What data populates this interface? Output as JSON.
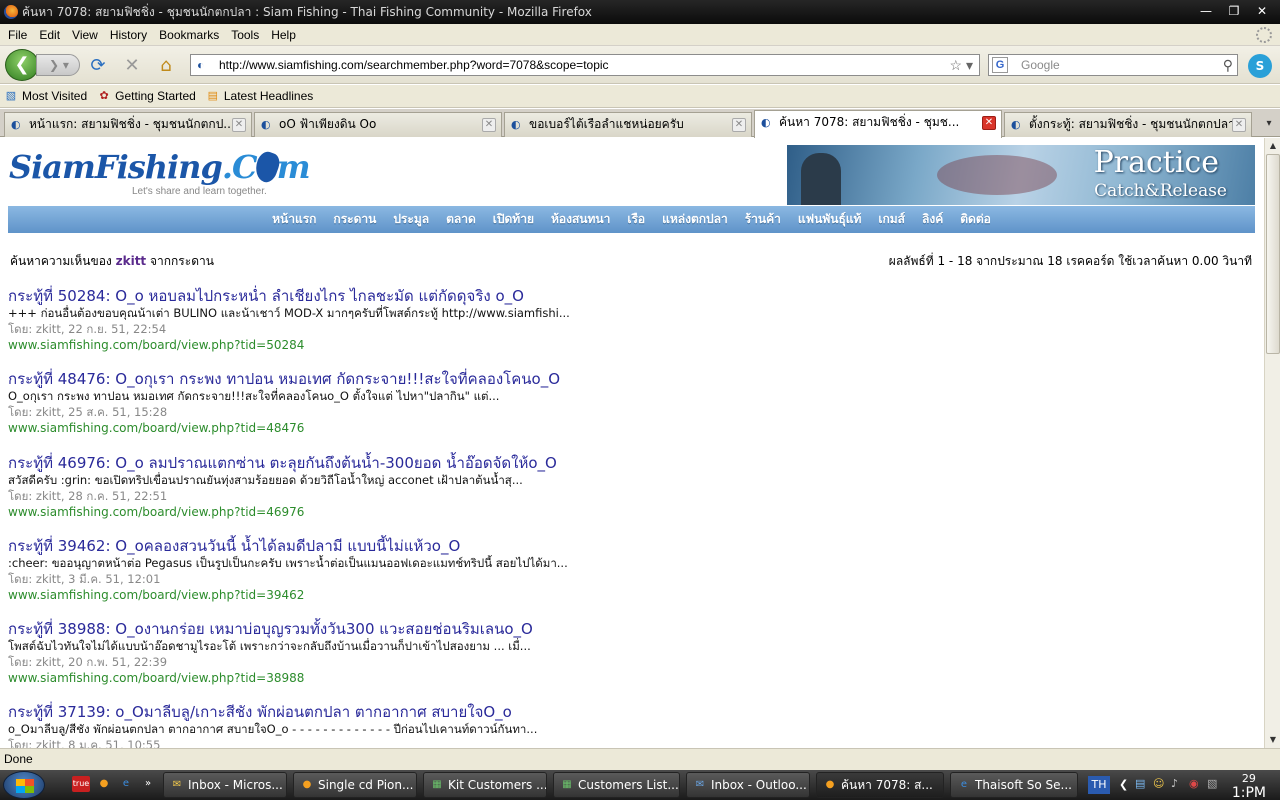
{
  "window": {
    "title": "ค้นหา 7078: สยามฟิชชิ่ง - ชุมชนนักตกปลา : Siam Fishing - Thai Fishing Community - Mozilla Firefox"
  },
  "menu": [
    "File",
    "Edit",
    "View",
    "History",
    "Bookmarks",
    "Tools",
    "Help"
  ],
  "nav": {
    "url": "http://www.siamfishing.com/searchmember.php?word=7078&scope=topic",
    "search_placeholder": "Google"
  },
  "bookmarks": [
    "Most Visited",
    "Getting Started",
    "Latest Headlines"
  ],
  "tabs": [
    {
      "label": "หน้าแรก: สยามฟิชชิ่ง - ชุมชนนักตกป..."
    },
    {
      "label": "oO ฟ้าเพียงดิน Oo"
    },
    {
      "label": "ขอเบอร์ไต้เรือลำแชหน่อยครับ"
    },
    {
      "label": "ค้นหา 7078: สยามฟิชชิ่ง - ชุมช..."
    },
    {
      "label": "ตั้งกระทู้: สยามฟิชชิ่ง - ชุมชนนักตกปลา..."
    }
  ],
  "site": {
    "logo": "SiamFishing",
    "logo_com": ".Com",
    "tagline": "Let's share and learn together.",
    "banner_title": "Practice",
    "banner_sub": "Catch&Release",
    "nav": [
      "หน้าแรก",
      "กระดาน",
      "ประมูล",
      "ตลาด",
      "เปิดท้าย",
      "ห้องสนทนา",
      "เรือ",
      "แหล่งตกปลา",
      "ร้านค้า",
      "แฟนพันธุ์แท้",
      "เกมส์",
      "ลิงค์",
      "ติดต่อ"
    ]
  },
  "search": {
    "prefix": "ค้นหาความเห็นของ",
    "user": "zkitt",
    "suffix": "จากกระดาน",
    "results_info": "ผลลัพธ์ที่ 1 - 18 จากประมาณ 18 เรคคอร์ด ใช้เวลาค้นหา 0.00 วินาที"
  },
  "results": [
    {
      "title": "กระทู้ที่ 50284: O_o หอบลมไปกระหน่ำ ลำเชียงไกร ไกลชะมัด แต่กัดดุจริง o_O",
      "snippet": "+++ ก่อนอื่นต้องขอบคุณน้าเต่า BULINO และน้าเชาว์ MOD-X มากๆครับที่โพสต์กระทู้ http://www.siamfishi...",
      "meta": "โดย: zkitt, 22 ก.ย. 51, 22:54",
      "url": "www.siamfishing.com/board/view.php?tid=50284"
    },
    {
      "title": "กระทู้ที่ 48476: O_oกุเรา กระพง ทาปอน หมอเทศ กัดกระจาย!!!สะใจที่คลองโคนo_O",
      "snippet": "O_oกุเรา กระพง ทาปอน หมอเทศ กัดกระจาย!!!สะใจที่คลองโคนo_O ตั้งใจแต่ ไปหา\"ปลากิน\" แต่...",
      "meta": "โดย: zkitt, 25 ส.ค. 51, 15:28",
      "url": "www.siamfishing.com/board/view.php?tid=48476"
    },
    {
      "title": "กระทู้ที่ 46976: O_o ลมปราณแตกซ่าน ตะลุยกันถึงต้นน้ำ-300ยอด น้ำอ๊อดจัดให้o_O",
      "snippet": "สวัสดีครับ :grin: ขอเปิดทริปเขื่อนปราณยันทุ่งสามร้อยยอด ด้วยวิถีโอน้ำใหญ่ acconet เฝ้าปลาต้นน้ำสุ...",
      "meta": "โดย: zkitt, 28 ก.ค. 51, 22:51",
      "url": "www.siamfishing.com/board/view.php?tid=46976"
    },
    {
      "title": "กระทู้ที่ 39462: O_oคลองสวนวันนี้ น้ำได้ลมดีปลามี แบบนี้ไม่แห้วo_O",
      "snippet": ":cheer: ขออนุญาตหน้าต่อ Pegasus เป็นรูปเป็นกะครับ เพราะน้ำต่อเป็นแมนออฟเดอะแมทช์ทริปนี้ สอยไปได้มา...",
      "meta": "โดย: zkitt, 3 มี.ค. 51, 12:01",
      "url": "www.siamfishing.com/board/view.php?tid=39462"
    },
    {
      "title": "กระทู้ที่ 38988: O_oงานกร่อย เหมาบ่อบุญรวมทั้งวัน300 แวะสอยช่อนริมเลนo_O",
      "snippet": "โพสต์ฉับไวทันใจไม่ได้แบบน้าอ๊อดชามูไรอะโต้ เพราะกว่าจะกลับถึงบ้านเมื่อวานก็ปาเข้าไปสองยาม ... เมื่...",
      "meta": "โดย: zkitt, 20 ก.พ. 51, 22:39",
      "url": "www.siamfishing.com/board/view.php?tid=38988"
    },
    {
      "title": "กระทู้ที่ 37139: o_Oมาลีบลู/เกาะสีชัง พักผ่อนตกปลา ตากอากาศ สบายใจO_o",
      "snippet": "o_Oมาลีบลู/สีชัง พักผ่อนตกปลา ตากอากาศ สบายใจO_o - - - - - - - - - - - - - ปีก่อนไปเคานท์ดาวน์กันทา...",
      "meta": "โดย: zkitt, 8 ม.ค. 51, 10:55",
      "url": ""
    }
  ],
  "status": "Done",
  "taskbar": {
    "items": [
      "Inbox - Micros...",
      "Single cd Pion...",
      "Kit Customers ...",
      "Customers List...",
      "Inbox - Outloo...",
      "ค้นหา 7078: ส...",
      "Thaisoft So Se..."
    ],
    "lang": "TH",
    "clock_day": "29",
    "clock_time": "1:PM"
  }
}
